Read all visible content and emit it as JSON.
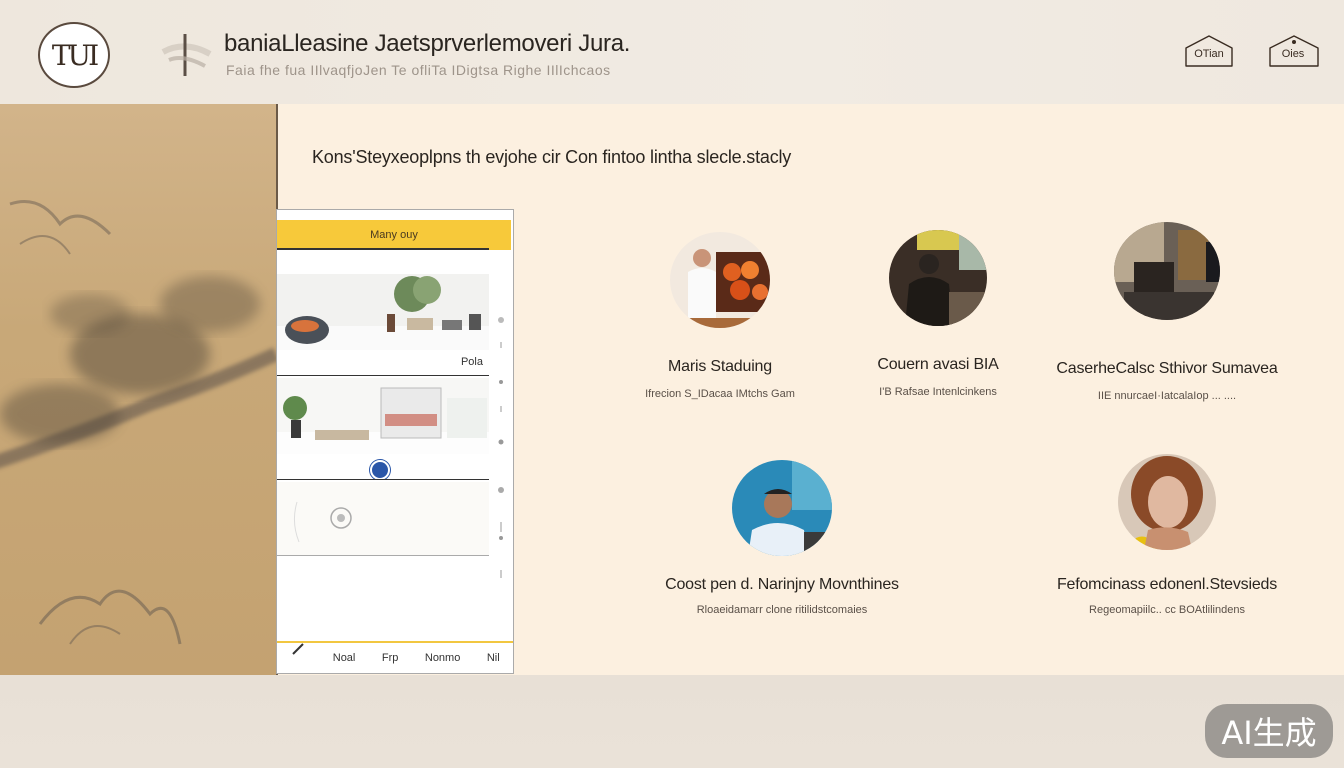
{
  "header": {
    "logo_text": "TUI",
    "title": "baniaLleasine Jaetsprverlemoveri Jura.",
    "subtitle": "Faia fhe fua IIlvaqfjoJen Te ofliTa IDigtsa Righe IIlIchcaos",
    "nav_buttons": [
      {
        "label": "OTian"
      },
      {
        "label": "Oies"
      }
    ]
  },
  "main": {
    "intro": "Kons'Steyxeoplpns th evjohe cir Con fintoo lintha slecle.stacly",
    "phone": {
      "header": "Many ouy",
      "card1_caption": "Pola",
      "nav": [
        "Noal",
        "Frp",
        "Nonmo",
        "Nil"
      ]
    },
    "people": [
      {
        "name": "Maris Staduing",
        "desc": "Ifrecion S_IDacaa IMtchs Gam"
      },
      {
        "name": "Couern avasi BIA",
        "desc": "I'B Rafsae Intenlcinkens"
      },
      {
        "name": "CaserheCalsc Sthivor Sumavea",
        "desc": "IIE nnurcaeI·IatcalaIop ... ...."
      },
      {
        "name": "Coost pen d. Narinjny Movnthines",
        "desc": "Rloaeidamarr clone ritilidstcomaies"
      },
      {
        "name": "Fefomcinass edonenl.Stevsieds",
        "desc": "Regeomapiilc.. cc BOAtlilindens"
      }
    ]
  },
  "badge": {
    "text": "AI生成"
  }
}
